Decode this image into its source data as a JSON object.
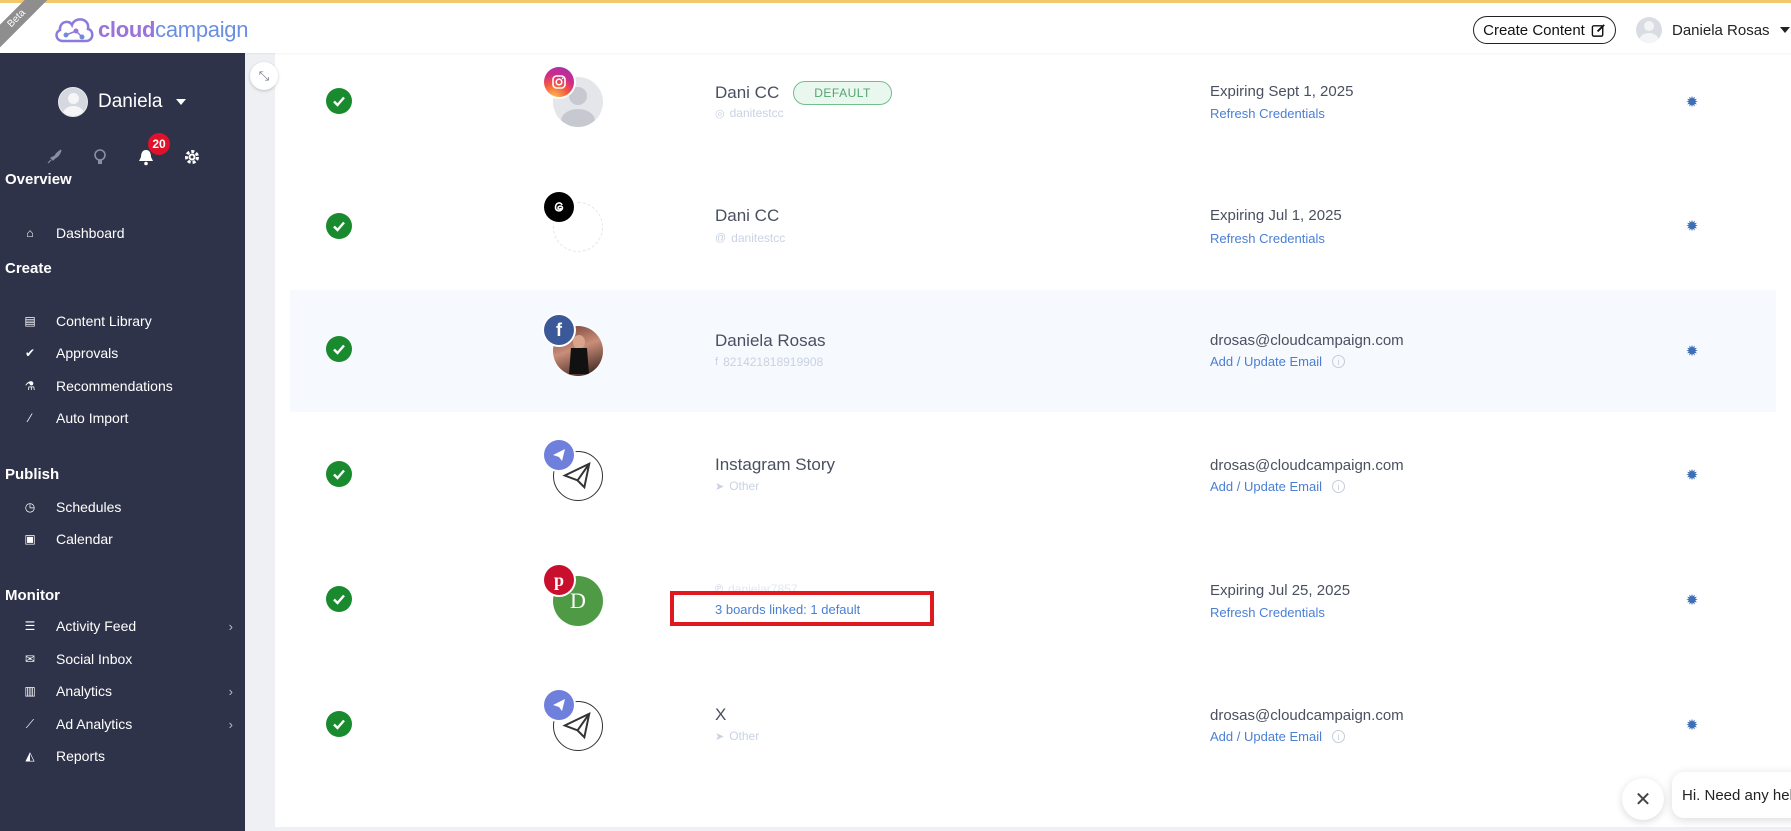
{
  "topbar": {
    "beta_label": "Beta",
    "logo_part1": "cloud",
    "logo_part2": "campaign",
    "create_content_label": "Create Content",
    "user_name": "Daniela Rosas"
  },
  "sidebar": {
    "user_name": "Daniela",
    "notification_count": "20",
    "sections": [
      {
        "title": "Overview",
        "items": [
          {
            "label": "Dashboard",
            "icon": "home-icon"
          }
        ]
      },
      {
        "title": "Create",
        "items": [
          {
            "label": "Content Library",
            "icon": "file-image-icon"
          },
          {
            "label": "Approvals",
            "icon": "check-circle-icon"
          },
          {
            "label": "Recommendations",
            "icon": "flask-icon"
          },
          {
            "label": "Auto Import",
            "icon": "magic-wand-icon"
          }
        ]
      },
      {
        "title": "Publish",
        "items": [
          {
            "label": "Schedules",
            "icon": "clock-icon"
          },
          {
            "label": "Calendar",
            "icon": "calendar-check-icon"
          }
        ]
      },
      {
        "title": "Monitor",
        "items": [
          {
            "label": "Activity Feed",
            "icon": "list-icon"
          },
          {
            "label": "Social Inbox",
            "icon": "envelope-icon"
          },
          {
            "label": "Analytics",
            "icon": "bar-chart-icon"
          },
          {
            "label": "Ad Analytics",
            "icon": "line-chart-icon"
          },
          {
            "label": "Reports",
            "icon": "area-chart-icon"
          }
        ]
      }
    ]
  },
  "accounts": [
    {
      "name": "Dani CC",
      "badge": "DEFAULT",
      "network": "instagram",
      "handle": "danitestcc",
      "status": "Expiring Sept 1, 2025",
      "action": "Refresh Credentials"
    },
    {
      "name": "Dani CC",
      "badge": "",
      "network": "threads",
      "handle": "danitestcc",
      "status": "Expiring Jul 1, 2025",
      "action": "Refresh Credentials"
    },
    {
      "name": "Daniela Rosas",
      "badge": "",
      "network": "facebook",
      "handle": "821421818919908",
      "status": "drosas@cloudcampaign.com",
      "action": "Add / Update Email"
    },
    {
      "name": "Instagram Story",
      "badge": "",
      "network": "other",
      "handle": "Other",
      "status": "drosas@cloudcampaign.com",
      "action": "Add / Update Email"
    },
    {
      "name": "",
      "badge": "",
      "network": "pinterest",
      "handle": "danielar7857",
      "avatar_letter": "D",
      "boards_link": "3 boards linked: 1 default",
      "status": "Expiring Jul 25, 2025",
      "action": "Refresh Credentials"
    },
    {
      "name": "X",
      "badge": "",
      "network": "other",
      "handle": "Other",
      "status": "drosas@cloudcampaign.com",
      "action": "Add / Update Email"
    }
  ],
  "chat": {
    "greeting": "Hi. Need any help?"
  },
  "colors": {
    "sidebar_bg": "#2f3349",
    "accent_link": "#4a7fd4",
    "success_green": "#1a8a2e",
    "highlight_red": "#e0191f"
  }
}
